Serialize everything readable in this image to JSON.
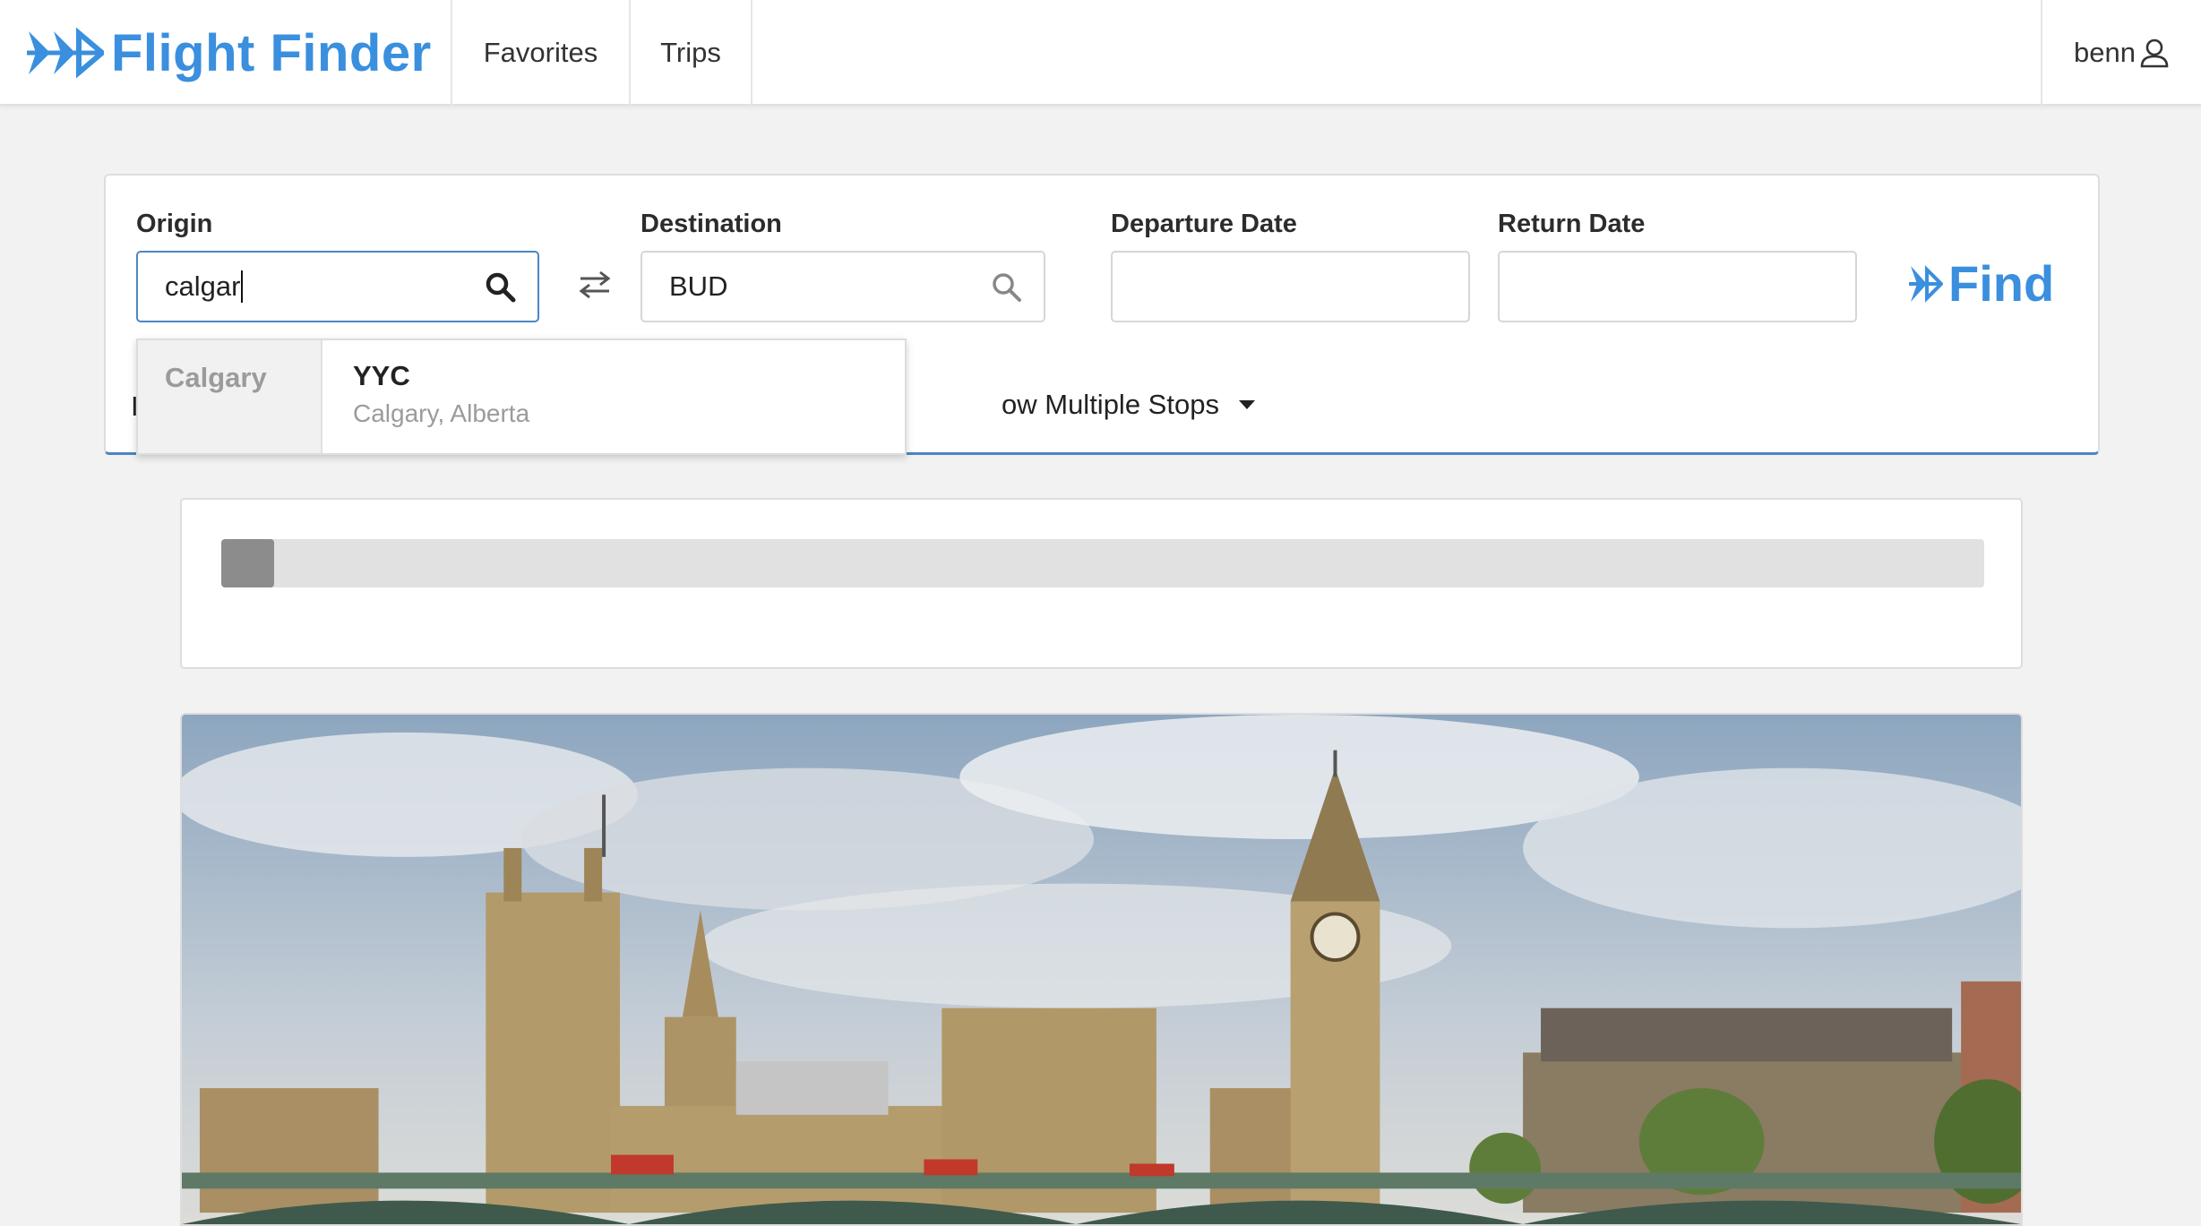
{
  "app": {
    "name": "Flight Finder"
  },
  "nav": {
    "items": [
      {
        "label": "Favorites"
      },
      {
        "label": "Trips"
      }
    ]
  },
  "user": {
    "name": "benn",
    "icon": "user-icon"
  },
  "search": {
    "origin": {
      "label": "Origin",
      "value": "calgar",
      "icon": "search-icon"
    },
    "swap_icon": "swap-arrows-icon",
    "destination": {
      "label": "Destination",
      "value": "BUD",
      "icon": "search-icon"
    },
    "departure_date": {
      "label": "Departure Date",
      "value": ""
    },
    "return_date": {
      "label": "Return Date",
      "value": ""
    },
    "find_label": "Find",
    "stops": {
      "label": "ow Multiple Stops",
      "icon": "caret-down-icon"
    },
    "hidden_label_fragment": "I"
  },
  "autocomplete": {
    "group": "Calgary",
    "options": [
      {
        "code": "YYC",
        "name": "Calgary, Alberta"
      }
    ]
  },
  "progress": {
    "fraction": 0.03
  },
  "hero": {
    "description_icon": "london-westminster-photo"
  },
  "colors": {
    "brand": "#3a8fde",
    "focus_border": "#4a86c5",
    "progress_fill": "#8c8c8c"
  }
}
